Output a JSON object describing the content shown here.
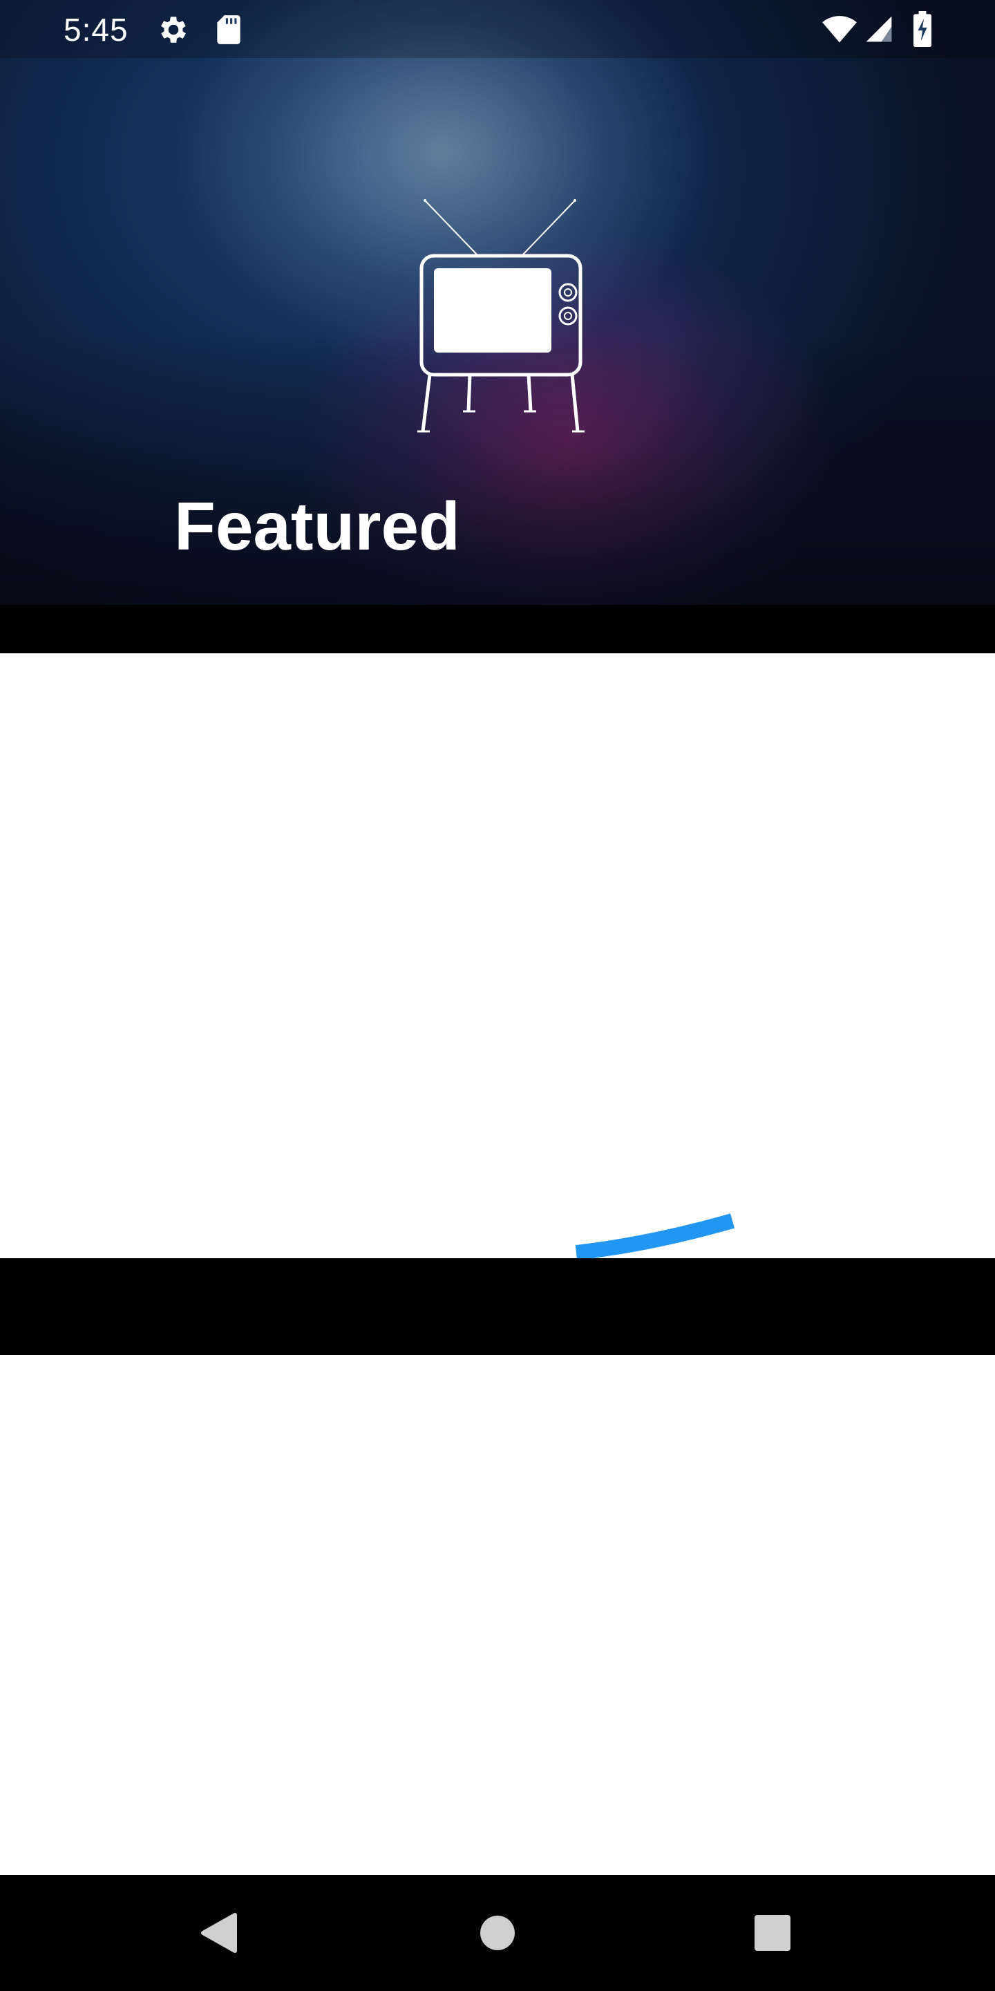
{
  "status_bar": {
    "time": "5:45",
    "left_icons": [
      "gear-icon",
      "sd-card-icon"
    ],
    "right_icons": [
      "wifi-icon",
      "cell-signal-icon",
      "battery-charging-icon"
    ]
  },
  "hero": {
    "icon": "tv-icon",
    "title": "Featured"
  },
  "content": {
    "loading_indicator": "progress-spinner",
    "accent_color": "#2196F3"
  },
  "nav_bar": {
    "buttons": [
      "back-icon",
      "home-icon",
      "recents-icon"
    ]
  }
}
